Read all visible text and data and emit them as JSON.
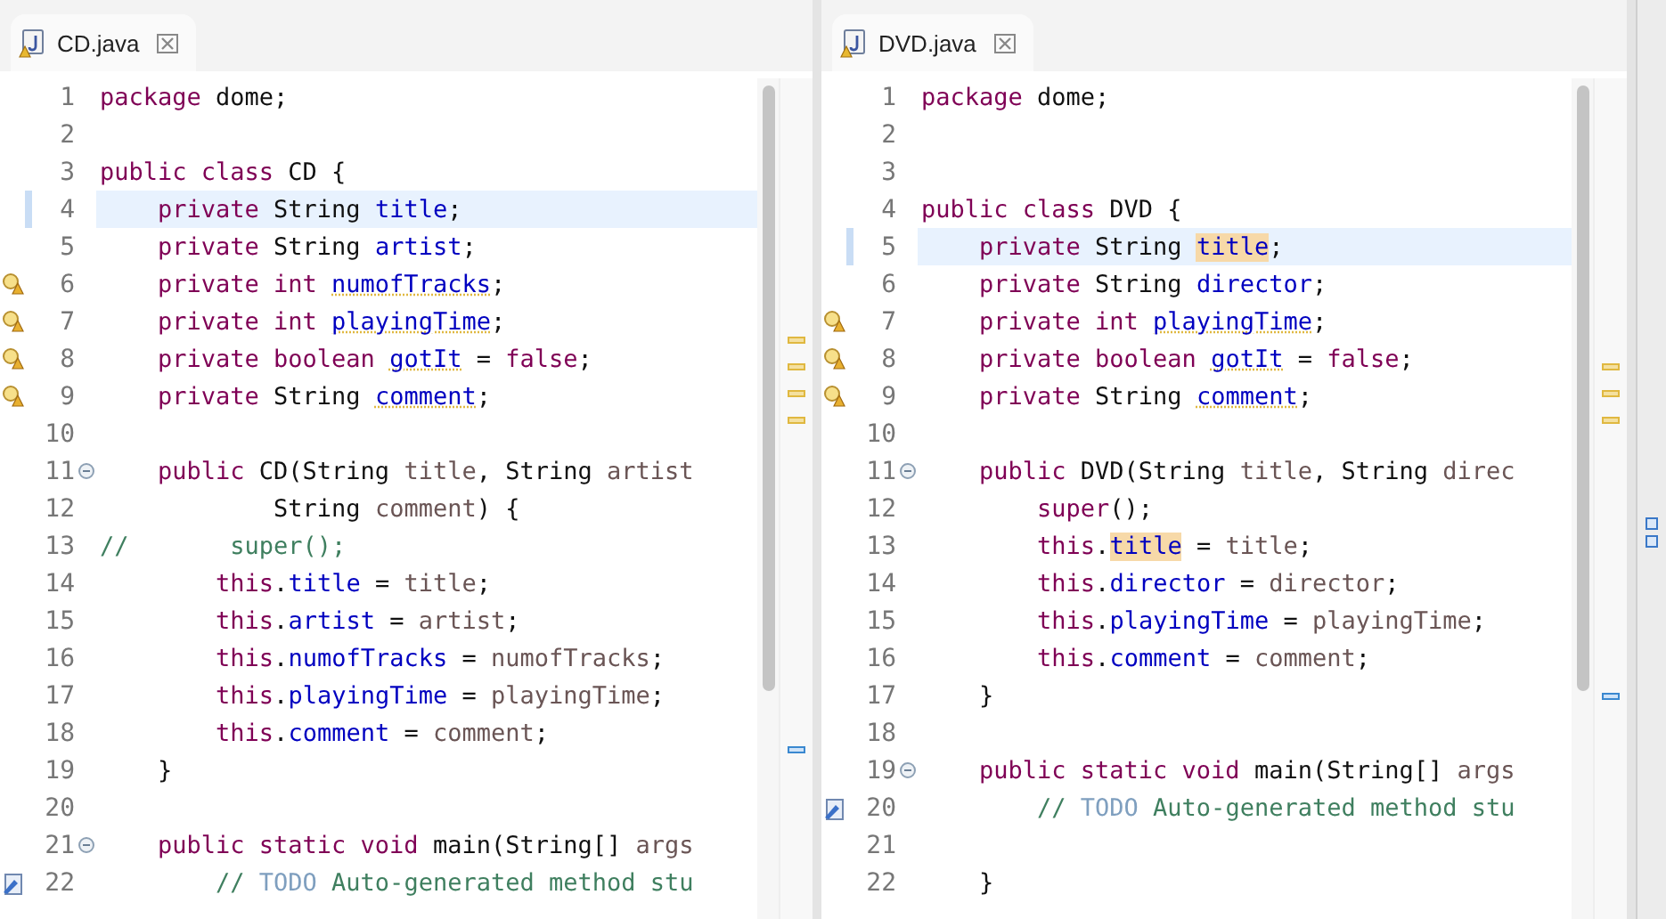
{
  "panes": [
    {
      "tab": {
        "title": "CD.java"
      },
      "lines": [
        {
          "number": "1",
          "kind": "code",
          "current": false,
          "fold": false,
          "tokens": [
            {
              "kind": "keyword",
              "text": "package"
            },
            {
              "kind": "text",
              "text": " dome;"
            }
          ]
        },
        {
          "number": "2",
          "kind": "code",
          "current": false,
          "fold": false
        },
        {
          "number": "3",
          "kind": "code",
          "current": false,
          "fold": false,
          "tokens": [
            {
              "kind": "keyword",
              "text": "public class"
            },
            {
              "kind": "text",
              "text": " CD {"
            }
          ]
        },
        {
          "number": "4",
          "kind": "code",
          "current": true,
          "fold": false,
          "tokens": [
            {
              "kind": "keyword",
              "text": "    private"
            },
            {
              "kind": "text",
              "text": " String "
            },
            {
              "kind": "field",
              "text": "title"
            },
            {
              "kind": "text",
              "text": ";"
            }
          ]
        },
        {
          "number": "5",
          "kind": "code",
          "current": false,
          "fold": false,
          "tokens": [
            {
              "kind": "keyword",
              "text": "    private"
            },
            {
              "kind": "text",
              "text": " String "
            },
            {
              "kind": "field",
              "text": "artist"
            },
            {
              "kind": "text",
              "text": ";"
            }
          ]
        },
        {
          "number": "6",
          "kind": "warning",
          "current": false,
          "fold": false,
          "tokens": [
            {
              "kind": "keyword",
              "text": "    private int "
            },
            {
              "kind": "unused",
              "text": "numofTracks"
            },
            {
              "kind": "text",
              "text": ";"
            }
          ]
        },
        {
          "number": "7",
          "kind": "warning",
          "current": false,
          "fold": false,
          "tokens": [
            {
              "kind": "keyword",
              "text": "    private int "
            },
            {
              "kind": "unused",
              "text": "playingTime"
            },
            {
              "kind": "text",
              "text": ";"
            }
          ]
        },
        {
          "number": "8",
          "kind": "warning",
          "current": false,
          "fold": false,
          "tokens": [
            {
              "kind": "keyword",
              "text": "    private boolean "
            },
            {
              "kind": "unused",
              "text": "gotIt"
            },
            {
              "kind": "text",
              "text": " = "
            },
            {
              "kind": "keyword",
              "text": "false"
            },
            {
              "kind": "text",
              "text": ";"
            }
          ]
        },
        {
          "number": "9",
          "kind": "warning",
          "current": false,
          "fold": false,
          "tokens": [
            {
              "kind": "keyword",
              "text": "    private"
            },
            {
              "kind": "text",
              "text": " String "
            },
            {
              "kind": "unused",
              "text": "comment"
            },
            {
              "kind": "text",
              "text": ";"
            }
          ]
        },
        {
          "number": "10",
          "kind": "code",
          "current": false,
          "fold": false
        },
        {
          "number": "11",
          "kind": "code",
          "current": false,
          "fold": true,
          "tokens": [
            {
              "kind": "keyword",
              "text": "    public"
            },
            {
              "kind": "text",
              "text": " CD(String "
            },
            {
              "kind": "param",
              "text": "title"
            },
            {
              "kind": "text",
              "text": ", String "
            },
            {
              "kind": "param",
              "text": "artist"
            }
          ]
        },
        {
          "number": "12",
          "kind": "code",
          "current": false,
          "fold": false,
          "tokens": [
            {
              "kind": "text",
              "text": "            String "
            },
            {
              "kind": "param",
              "text": "comment"
            },
            {
              "kind": "text",
              "text": ") {"
            }
          ]
        },
        {
          "number": "13",
          "kind": "code",
          "current": false,
          "fold": false,
          "tokens": [
            {
              "kind": "comment",
              "text": "//       super();"
            }
          ]
        },
        {
          "number": "14",
          "kind": "code",
          "current": false,
          "fold": false,
          "tokens": [
            {
              "kind": "keyword",
              "text": "        this"
            },
            {
              "kind": "text",
              "text": "."
            },
            {
              "kind": "field",
              "text": "title"
            },
            {
              "kind": "text",
              "text": " = "
            },
            {
              "kind": "param",
              "text": "title"
            },
            {
              "kind": "text",
              "text": ";"
            }
          ]
        },
        {
          "number": "15",
          "kind": "code",
          "current": false,
          "fold": false,
          "tokens": [
            {
              "kind": "keyword",
              "text": "        this"
            },
            {
              "kind": "text",
              "text": "."
            },
            {
              "kind": "field",
              "text": "artist"
            },
            {
              "kind": "text",
              "text": " = "
            },
            {
              "kind": "param",
              "text": "artist"
            },
            {
              "kind": "text",
              "text": ";"
            }
          ]
        },
        {
          "number": "16",
          "kind": "code",
          "current": false,
          "fold": false,
          "tokens": [
            {
              "kind": "keyword",
              "text": "        this"
            },
            {
              "kind": "text",
              "text": "."
            },
            {
              "kind": "field",
              "text": "numofTracks"
            },
            {
              "kind": "text",
              "text": " = "
            },
            {
              "kind": "param",
              "text": "numofTracks"
            },
            {
              "kind": "text",
              "text": ";"
            }
          ]
        },
        {
          "number": "17",
          "kind": "code",
          "current": false,
          "fold": false,
          "tokens": [
            {
              "kind": "keyword",
              "text": "        this"
            },
            {
              "kind": "text",
              "text": "."
            },
            {
              "kind": "field",
              "text": "playingTime"
            },
            {
              "kind": "text",
              "text": " = "
            },
            {
              "kind": "param",
              "text": "playingTime"
            },
            {
              "kind": "text",
              "text": ";"
            }
          ]
        },
        {
          "number": "18",
          "kind": "code",
          "current": false,
          "fold": false,
          "tokens": [
            {
              "kind": "keyword",
              "text": "        this"
            },
            {
              "kind": "text",
              "text": "."
            },
            {
              "kind": "field",
              "text": "comment"
            },
            {
              "kind": "text",
              "text": " = "
            },
            {
              "kind": "param",
              "text": "comment"
            },
            {
              "kind": "text",
              "text": ";"
            }
          ]
        },
        {
          "number": "19",
          "kind": "code",
          "current": false,
          "fold": false,
          "tokens": [
            {
              "kind": "text",
              "text": "    }"
            }
          ]
        },
        {
          "number": "20",
          "kind": "code",
          "current": false,
          "fold": false
        },
        {
          "number": "21",
          "kind": "code",
          "current": false,
          "fold": true,
          "tokens": [
            {
              "kind": "keyword",
              "text": "    public static void"
            },
            {
              "kind": "text",
              "text": " main(String[] "
            },
            {
              "kind": "param",
              "text": "args"
            }
          ]
        },
        {
          "number": "22",
          "kind": "task",
          "current": false,
          "fold": false,
          "tokens": [
            {
              "kind": "comment",
              "text": "        // "
            },
            {
              "kind": "todo",
              "text": "TODO"
            },
            {
              "kind": "comment",
              "text": " Auto-generated method stu"
            }
          ]
        }
      ]
    },
    {
      "tab": {
        "title": "DVD.java"
      },
      "lines": [
        {
          "number": "1",
          "kind": "code",
          "current": false,
          "fold": false,
          "tokens": [
            {
              "kind": "keyword",
              "text": "package"
            },
            {
              "kind": "text",
              "text": " dome;"
            }
          ]
        },
        {
          "number": "2",
          "kind": "code",
          "current": false,
          "fold": false
        },
        {
          "number": "3",
          "kind": "code",
          "current": false,
          "fold": false
        },
        {
          "number": "4",
          "kind": "code",
          "current": false,
          "fold": false,
          "tokens": [
            {
              "kind": "keyword",
              "text": "public class"
            },
            {
              "kind": "text",
              "text": " DVD {"
            }
          ]
        },
        {
          "number": "5",
          "kind": "code",
          "current": true,
          "fold": false,
          "tokens": [
            {
              "kind": "keyword",
              "text": "    private"
            },
            {
              "kind": "text",
              "text": " String "
            },
            {
              "kind": "occurrence",
              "text": "title"
            },
            {
              "kind": "text",
              "text": ";"
            }
          ]
        },
        {
          "number": "6",
          "kind": "code",
          "current": false,
          "fold": false,
          "tokens": [
            {
              "kind": "keyword",
              "text": "    private"
            },
            {
              "kind": "text",
              "text": " String "
            },
            {
              "kind": "field",
              "text": "director"
            },
            {
              "kind": "text",
              "text": ";"
            }
          ]
        },
        {
          "number": "7",
          "kind": "warning",
          "current": false,
          "fold": false,
          "tokens": [
            {
              "kind": "keyword",
              "text": "    private int "
            },
            {
              "kind": "unused",
              "text": "playingTime"
            },
            {
              "kind": "text",
              "text": ";"
            }
          ]
        },
        {
          "number": "8",
          "kind": "warning",
          "current": false,
          "fold": false,
          "tokens": [
            {
              "kind": "keyword",
              "text": "    private boolean "
            },
            {
              "kind": "unused",
              "text": "gotIt"
            },
            {
              "kind": "text",
              "text": " = "
            },
            {
              "kind": "keyword",
              "text": "false"
            },
            {
              "kind": "text",
              "text": ";"
            }
          ]
        },
        {
          "number": "9",
          "kind": "warning",
          "current": false,
          "fold": false,
          "tokens": [
            {
              "kind": "keyword",
              "text": "    private"
            },
            {
              "kind": "text",
              "text": " String "
            },
            {
              "kind": "unused",
              "text": "comment"
            },
            {
              "kind": "text",
              "text": ";"
            }
          ]
        },
        {
          "number": "10",
          "kind": "code",
          "current": false,
          "fold": false
        },
        {
          "number": "11",
          "kind": "code",
          "current": false,
          "fold": true,
          "tokens": [
            {
              "kind": "keyword",
              "text": "    public"
            },
            {
              "kind": "text",
              "text": " DVD(String "
            },
            {
              "kind": "param",
              "text": "title"
            },
            {
              "kind": "text",
              "text": ", String "
            },
            {
              "kind": "param",
              "text": "direc"
            }
          ]
        },
        {
          "number": "12",
          "kind": "code",
          "current": false,
          "fold": false,
          "tokens": [
            {
              "kind": "keyword",
              "text": "        super"
            },
            {
              "kind": "text",
              "text": "();"
            }
          ]
        },
        {
          "number": "13",
          "kind": "code",
          "current": false,
          "fold": false,
          "tokens": [
            {
              "kind": "keyword",
              "text": "        this"
            },
            {
              "kind": "text",
              "text": "."
            },
            {
              "kind": "occurrence",
              "text": "title"
            },
            {
              "kind": "text",
              "text": " = "
            },
            {
              "kind": "param",
              "text": "title"
            },
            {
              "kind": "text",
              "text": ";"
            }
          ]
        },
        {
          "number": "14",
          "kind": "code",
          "current": false,
          "fold": false,
          "tokens": [
            {
              "kind": "keyword",
              "text": "        this"
            },
            {
              "kind": "text",
              "text": "."
            },
            {
              "kind": "field",
              "text": "director"
            },
            {
              "kind": "text",
              "text": " = "
            },
            {
              "kind": "param",
              "text": "director"
            },
            {
              "kind": "text",
              "text": ";"
            }
          ]
        },
        {
          "number": "15",
          "kind": "code",
          "current": false,
          "fold": false,
          "tokens": [
            {
              "kind": "keyword",
              "text": "        this"
            },
            {
              "kind": "text",
              "text": "."
            },
            {
              "kind": "field",
              "text": "playingTime"
            },
            {
              "kind": "text",
              "text": " = "
            },
            {
              "kind": "param",
              "text": "playingTime"
            },
            {
              "kind": "text",
              "text": ";"
            }
          ]
        },
        {
          "number": "16",
          "kind": "code",
          "current": false,
          "fold": false,
          "tokens": [
            {
              "kind": "keyword",
              "text": "        this"
            },
            {
              "kind": "text",
              "text": "."
            },
            {
              "kind": "field",
              "text": "comment"
            },
            {
              "kind": "text",
              "text": " = "
            },
            {
              "kind": "param",
              "text": "comment"
            },
            {
              "kind": "text",
              "text": ";"
            }
          ]
        },
        {
          "number": "17",
          "kind": "code",
          "current": false,
          "fold": false,
          "tokens": [
            {
              "kind": "text",
              "text": "    }"
            }
          ]
        },
        {
          "number": "18",
          "kind": "code",
          "current": false,
          "fold": false
        },
        {
          "number": "19",
          "kind": "code",
          "current": false,
          "fold": true,
          "tokens": [
            {
              "kind": "keyword",
              "text": "    public static void"
            },
            {
              "kind": "text",
              "text": " main(String[] "
            },
            {
              "kind": "param",
              "text": "args"
            }
          ]
        },
        {
          "number": "20",
          "kind": "task",
          "current": false,
          "fold": false,
          "tokens": [
            {
              "kind": "comment",
              "text": "        // "
            },
            {
              "kind": "todo",
              "text": "TODO"
            },
            {
              "kind": "comment",
              "text": " Auto-generated method stu"
            }
          ]
        },
        {
          "number": "21",
          "kind": "code",
          "current": false,
          "fold": false
        },
        {
          "number": "22",
          "kind": "code",
          "current": false,
          "fold": false,
          "tokens": [
            {
              "kind": "text",
              "text": "    }"
            }
          ]
        }
      ]
    }
  ]
}
